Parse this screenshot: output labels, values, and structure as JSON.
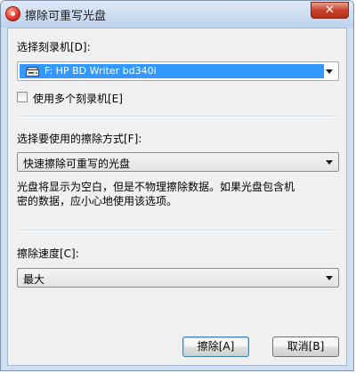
{
  "window": {
    "title": "擦除可重写光盘",
    "close_label": "✕"
  },
  "recorder": {
    "label": "选择刻录机[D]:",
    "selected": "F: HP BD Writer bd340i",
    "multi_checkbox_label": "使用多个刻录机[E]",
    "multi_checked": false
  },
  "erase_mode": {
    "label": "选择要使用的擦除方式[F]:",
    "selected": "快速擦除可重写的光盘",
    "description_line1": "光盘将显示为空白，但是不物理擦除数据。如果光盘包含机",
    "description_line2": "密的数据，应小心地使用该选项。"
  },
  "speed": {
    "label": "擦除速度[C]:",
    "selected": "最大"
  },
  "buttons": {
    "erase": "擦除[A]",
    "cancel": "取消[B]"
  },
  "icons": {
    "app": "disc-burner-icon",
    "drive": "optical-drive-icon",
    "dropdown": "chevron-down-icon",
    "close": "close-icon"
  },
  "colors": {
    "selection": "#3399ff",
    "close_button": "#c7432c",
    "titlebar": "#bdd2ec"
  }
}
